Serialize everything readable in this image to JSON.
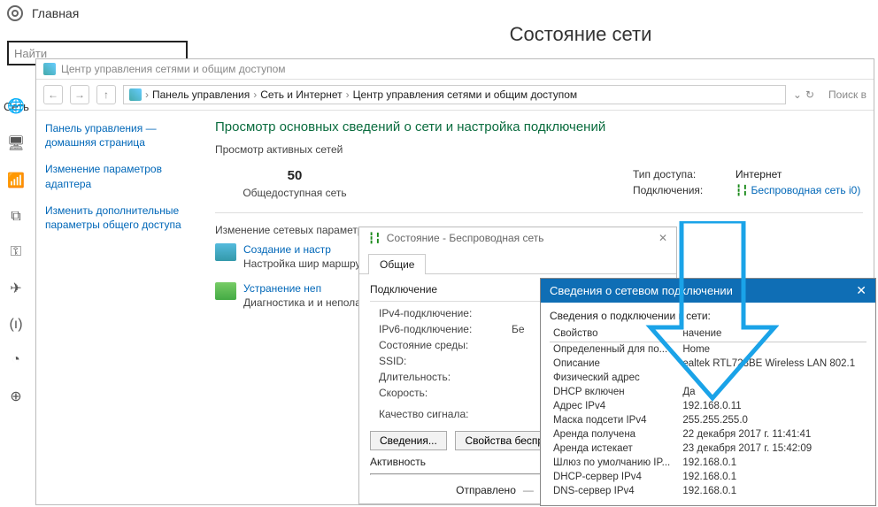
{
  "settings": {
    "home_label": "Главная",
    "page_heading": "Состояние сети",
    "search_placeholder": "Найти",
    "network_side": "Сеть"
  },
  "netcenter": {
    "title": "Центр управления сетями и общим доступом",
    "crumbs": [
      "Панель управления",
      "Сеть и Интернет",
      "Центр управления сетями и общим доступом"
    ],
    "search_hint": "Поиск в",
    "sidebar_links": [
      "Панель управления — домашняя страница",
      "Изменение параметров адаптера",
      "Изменить дополнительные параметры общего доступа"
    ],
    "heading": "Просмотр основных сведений о сети и настройка подключений",
    "active_label": "Просмотр активных сетей",
    "net_name": "50",
    "net_type": "Общедоступная сеть",
    "access_label": "Тип доступа:",
    "access_value": "Интернет",
    "conn_label": "Подключения:",
    "conn_value": "Беспроводная сеть i0)",
    "change_heading": "Изменение сетевых параметров",
    "items": [
      {
        "link": "Создание и настр",
        "desc": "Настройка шир маршрутизатор"
      },
      {
        "link": "Устранение неп",
        "desc": "Диагностика и и неполадок."
      }
    ]
  },
  "status": {
    "title": "Состояние - Беспроводная сеть",
    "tab": "Общие",
    "group1": "Подключение",
    "rows": [
      [
        "IPv4-подключение:",
        ""
      ],
      [
        "IPv6-подключение:",
        "Бе"
      ],
      [
        "Состояние среды:",
        ""
      ],
      [
        "SSID:",
        ""
      ],
      [
        "Длительность:",
        ""
      ],
      [
        "Скорость:",
        ""
      ]
    ],
    "quality": "Качество сигнала:",
    "btn_details": "Сведения...",
    "btn_props": "Свойства беспр",
    "activity": "Активность",
    "sent": "Отправлено"
  },
  "details": {
    "title": "Сведения о сетевом подключении",
    "subtitle": "Сведения о подключении к сети:",
    "col_prop": "Свойство",
    "col_val": "начение",
    "rows": [
      [
        "Определенный для по...",
        "Home"
      ],
      [
        "Описание",
        "ealtek RTL723BE Wireless LAN 802.1"
      ],
      [
        "Физический адрес",
        ""
      ],
      [
        "DHCP включен",
        "Да"
      ],
      [
        "Адрес IPv4",
        "192.168.0.11"
      ],
      [
        "Маска подсети IPv4",
        "255.255.255.0"
      ],
      [
        "Аренда получена",
        "22 декабря 2017 г. 11:41:41"
      ],
      [
        "Аренда истекает",
        "23 декабря 2017 г. 15:42:09"
      ],
      [
        "Шлюз по умолчанию IP...",
        "192.168.0.1"
      ],
      [
        "DHCP-сервер IPv4",
        "192.168.0.1"
      ],
      [
        "DNS-сервер IPv4",
        "192.168.0.1"
      ]
    ]
  }
}
